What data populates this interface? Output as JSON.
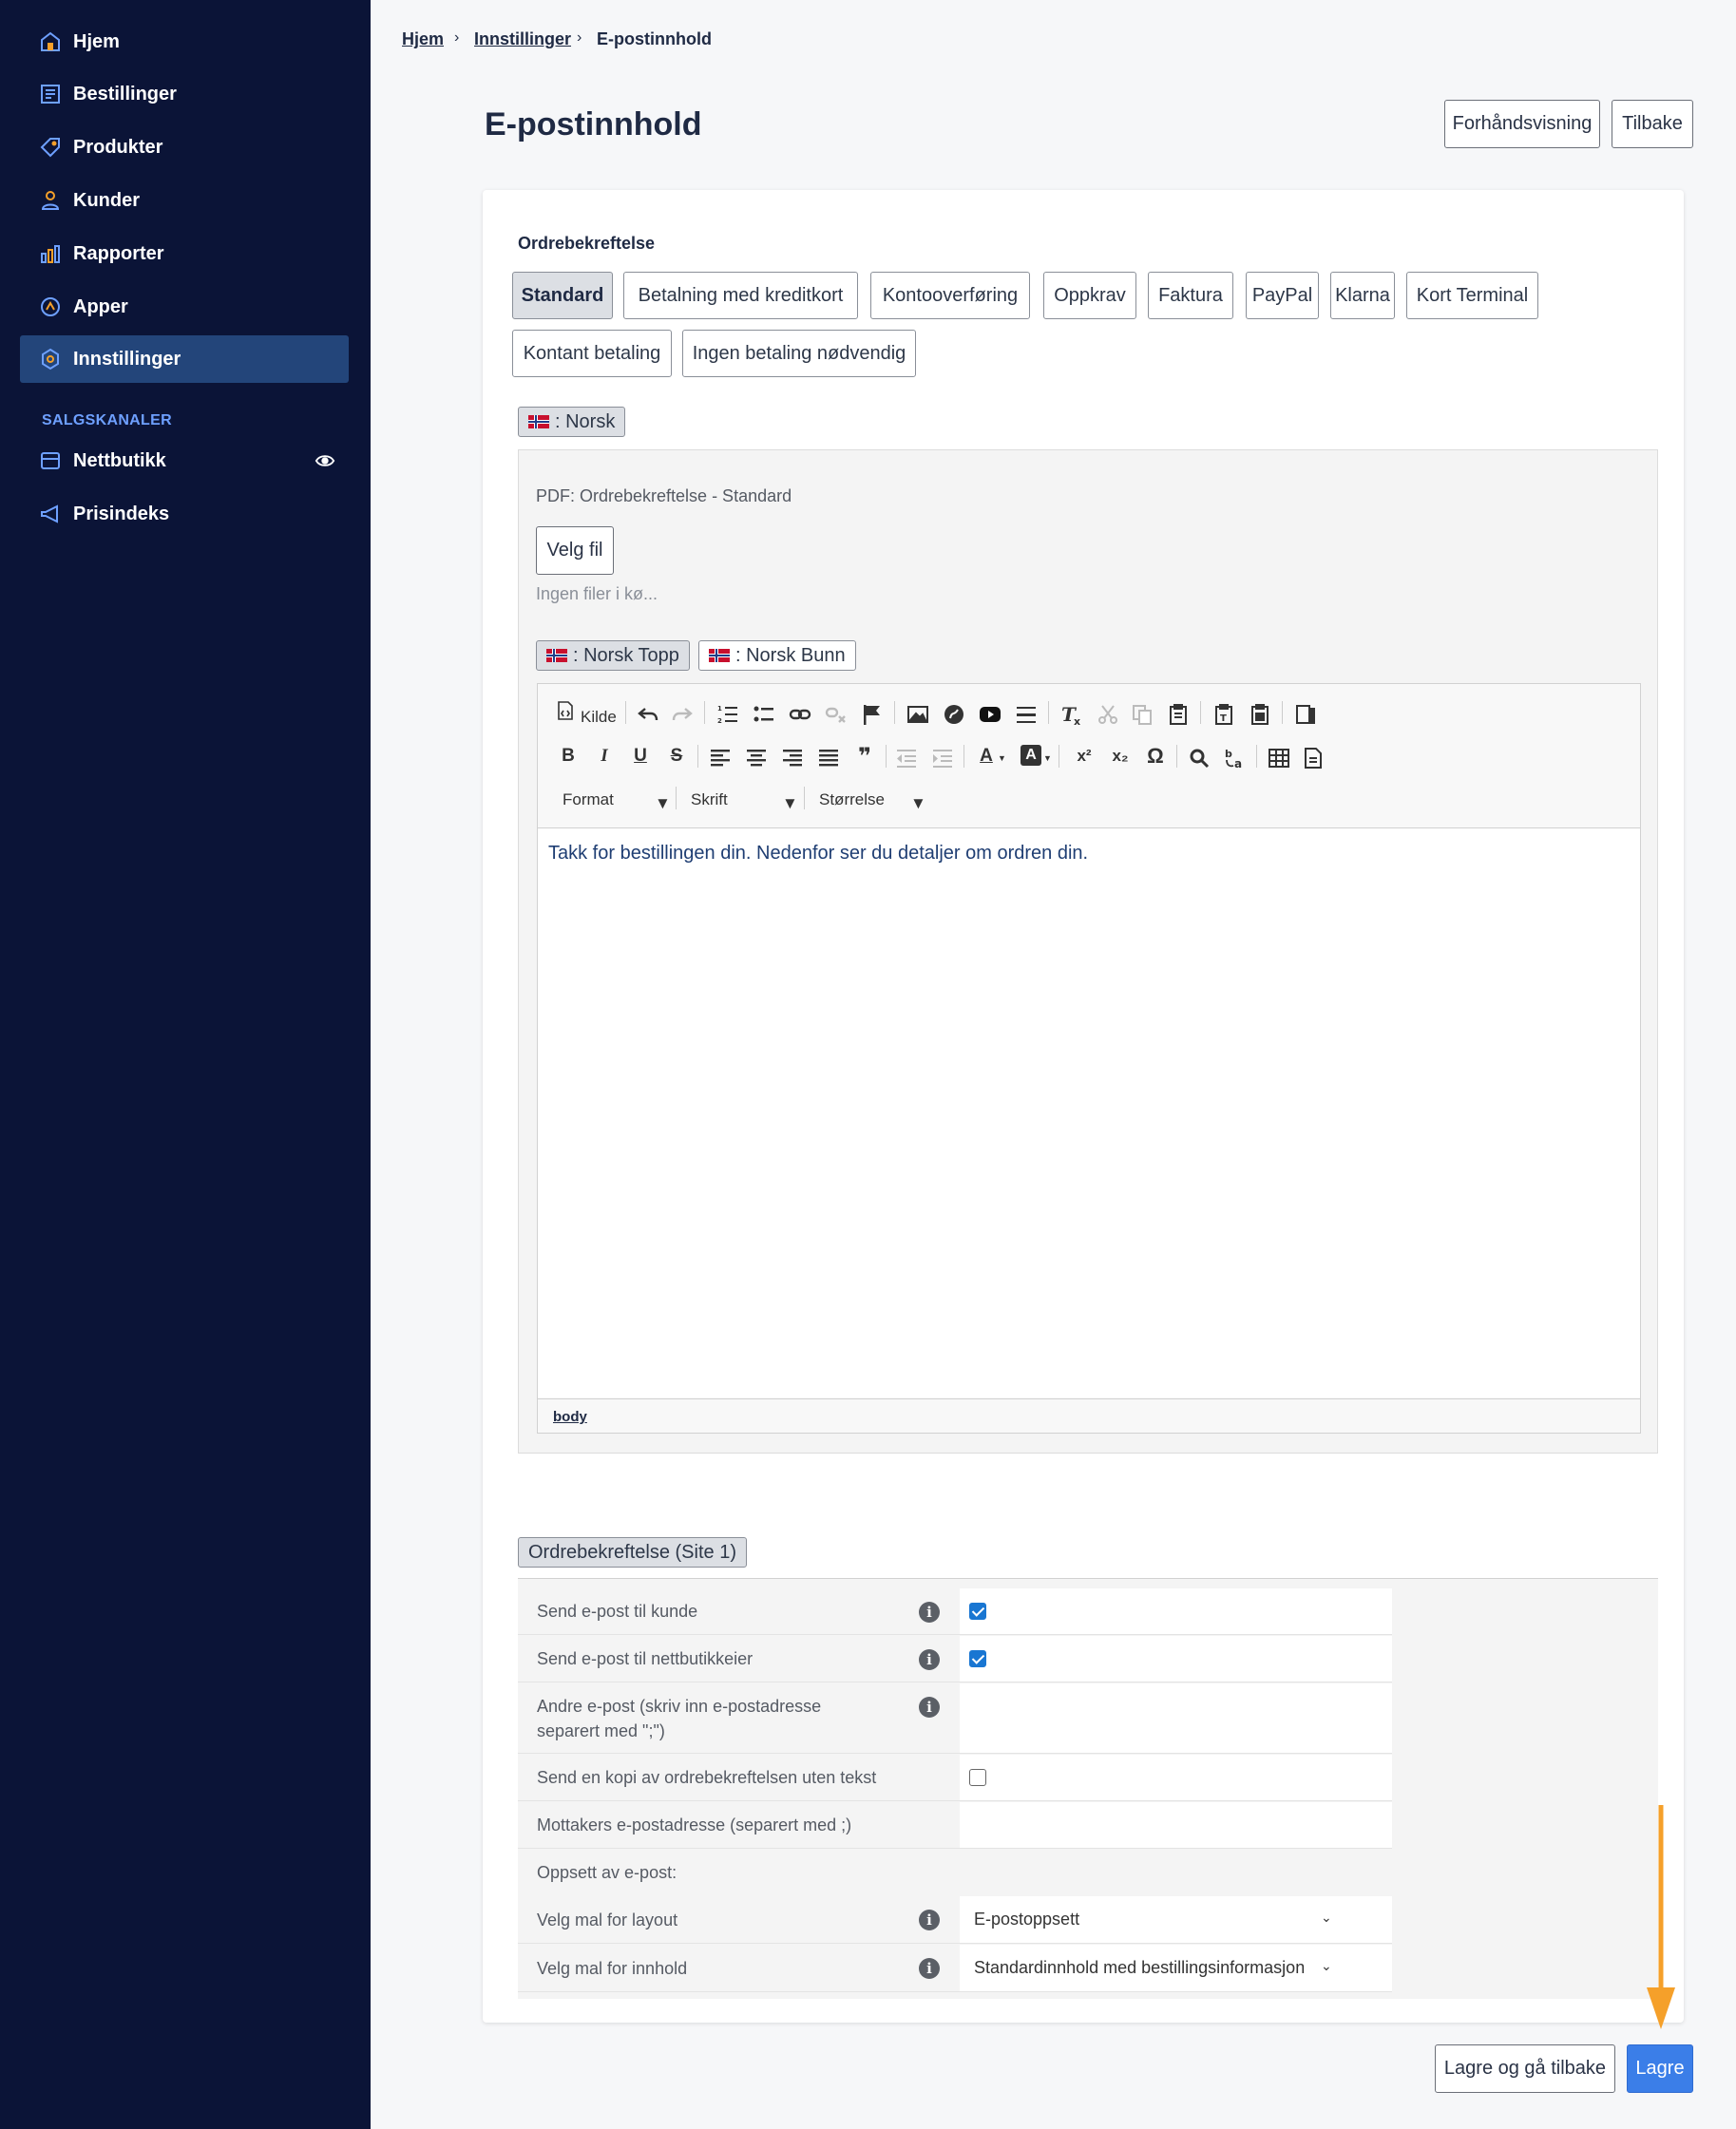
{
  "sidebar": {
    "items": [
      {
        "label": "Hjem",
        "icon": "home-icon"
      },
      {
        "label": "Bestillinger",
        "icon": "orders-icon"
      },
      {
        "label": "Produkter",
        "icon": "tag-icon"
      },
      {
        "label": "Kunder",
        "icon": "user-icon"
      },
      {
        "label": "Rapporter",
        "icon": "bar-chart-icon"
      },
      {
        "label": "Apper",
        "icon": "apps-icon"
      },
      {
        "label": "Innstillinger",
        "icon": "gear-icon",
        "active": true
      }
    ],
    "section_header": "SALGSKANALER",
    "channels": [
      {
        "label": "Nettbutikk",
        "icon": "store-icon",
        "extra_icon": "eye-icon"
      },
      {
        "label": "Prisindeks",
        "icon": "megaphone-icon"
      }
    ]
  },
  "breadcrumb": {
    "items": [
      "Hjem",
      "Innstillinger",
      "E-postinnhold"
    ],
    "separator": "›"
  },
  "page": {
    "title": "E-postinnhold",
    "preview_button": "Forhåndsvisning",
    "back_button": "Tilbake"
  },
  "section": {
    "title": "Ordrebekreftelse",
    "tabs": [
      "Standard",
      "Betalning med kreditkort",
      "Kontooverføring",
      "Oppkrav",
      "Faktura",
      "PayPal",
      "Klarna",
      "Kort Terminal",
      "Kontant betaling",
      "Ingen betaling nødvendig"
    ],
    "selected_tab": "Standard",
    "language_tab": ": Norsk",
    "pdf_label": "PDF: Ordrebekreftelse - Standard",
    "file_button": "Velg fil",
    "no_files": "Ingen filer i kø...",
    "content_tabs": [
      ": Norsk Topp",
      ": Norsk Bunn"
    ]
  },
  "editor": {
    "source_label": "Kilde",
    "format_label": "Format",
    "font_label": "Skrift",
    "size_label": "Størrelse",
    "content": "Takk for bestillingen din. Nedenfor ser du detaljer om ordren din.",
    "status_path": "body",
    "toolbar_glyphs": {
      "bold": "B",
      "italic": "I",
      "underline": "U",
      "strike": "S",
      "quote": "❞",
      "text_color": "A",
      "bg_color": "A",
      "superscript": "x²",
      "subscript": "x₂",
      "special_char": "Ω"
    }
  },
  "settings": {
    "group_label": "Ordrebekreftelse (Site 1)",
    "rows": [
      {
        "label": "Send e-post til kunde",
        "checked": true
      },
      {
        "label": "Send e-post til nettbutikkeier",
        "checked": true
      },
      {
        "label": "Andre e-post (skriv inn e-postadresse separert med \";\")"
      },
      {
        "label": "Send en kopi av ordrebekreftelsen uten tekst",
        "checked": false
      },
      {
        "label": "Mottakers e-postadresse (separert med ;)"
      },
      {
        "label": "Oppsett av e-post:"
      },
      {
        "label": "Velg mal for layout",
        "value": "E-postoppsett"
      },
      {
        "label": "Velg mal for innhold",
        "value": "Standardinnhold med bestillingsinformasjon"
      }
    ]
  },
  "footer": {
    "save_back_button": "Lagre og gå tilbake",
    "save_button": "Lagre"
  },
  "colors": {
    "sidebar_bg": "#0b1437",
    "sidebar_active": "#23457a",
    "primary": "#3b7ee8",
    "annotation_arrow": "#f5a02a"
  }
}
